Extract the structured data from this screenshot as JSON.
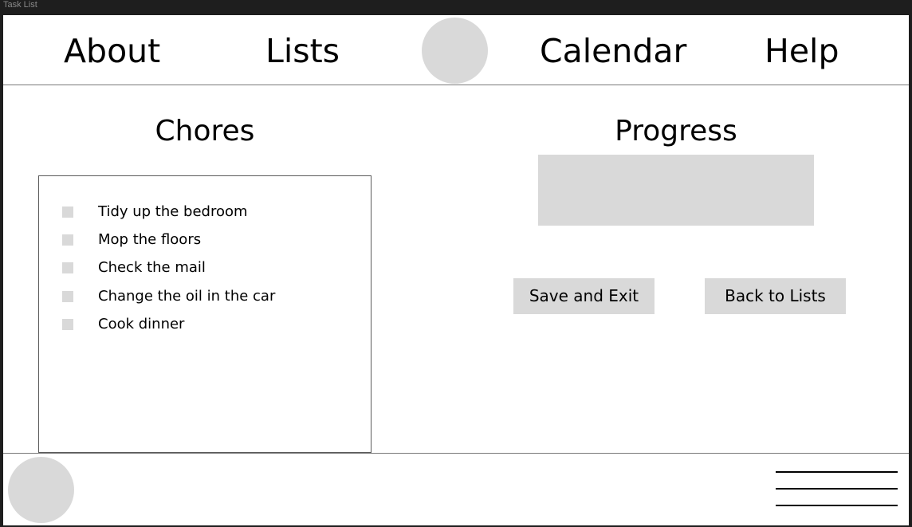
{
  "window": {
    "title": "Task List"
  },
  "header": {
    "nav": [
      {
        "label": "About"
      },
      {
        "label": "Lists"
      },
      {
        "label": "Calendar"
      },
      {
        "label": "Help"
      }
    ]
  },
  "chores": {
    "title": "Chores",
    "items": [
      {
        "label": "Tidy up the bedroom",
        "checked": false
      },
      {
        "label": "Mop the floors",
        "checked": false
      },
      {
        "label": "Check the mail",
        "checked": false
      },
      {
        "label": "Change the oil in the car",
        "checked": false
      },
      {
        "label": "Cook dinner",
        "checked": false
      }
    ]
  },
  "progress": {
    "title": "Progress"
  },
  "actions": {
    "save_label": "Save and Exit",
    "back_label": "Back to Lists"
  },
  "footer": {
    "menu_icon": "hamburger-menu-icon"
  },
  "colors": {
    "placeholder_gray": "#d9d9d9",
    "frame_dark": "#1e1e1e",
    "canvas_white": "#ffffff",
    "divider": "#7a7a7a"
  }
}
